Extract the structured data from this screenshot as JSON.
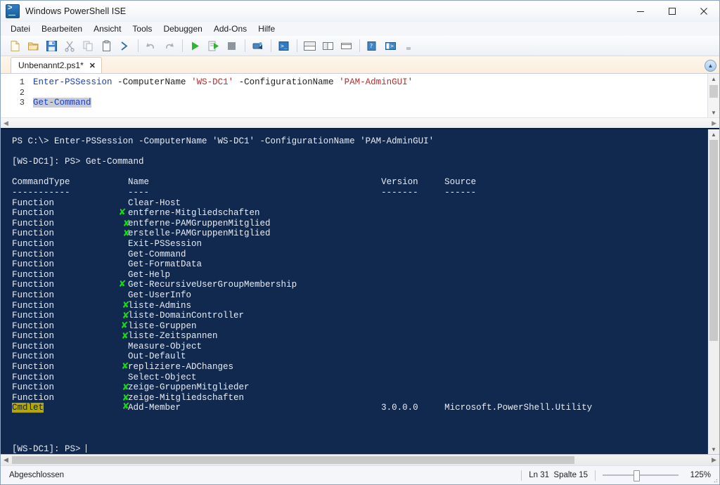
{
  "window": {
    "title": "Windows PowerShell ISE",
    "icon": "powershell-ise-icon",
    "minimize_label": "─",
    "maximize_label": "□",
    "close_label": "✕"
  },
  "menubar": {
    "items": [
      {
        "label": "Datei",
        "name": "menu-datei"
      },
      {
        "label": "Bearbeiten",
        "name": "menu-bearbeiten"
      },
      {
        "label": "Ansicht",
        "name": "menu-ansicht"
      },
      {
        "label": "Tools",
        "name": "menu-tools"
      },
      {
        "label": "Debuggen",
        "name": "menu-debuggen"
      },
      {
        "label": "Add-Ons",
        "name": "menu-add-ons"
      },
      {
        "label": "Hilfe",
        "name": "menu-hilfe"
      }
    ]
  },
  "toolbar": {
    "buttons": [
      "new-file-icon",
      "open-folder-icon",
      "save-icon",
      "cut-scissors-icon",
      "copy-icon",
      "paste-clipboard-icon",
      "run-prompt-icon",
      "undo-arrow-icon",
      "redo-arrow-icon",
      "run-script-play-icon",
      "run-selection-icon",
      "stop-script-icon",
      "new-remote-session-icon",
      "show-console-icon",
      "layout-top-bottom-icon",
      "layout-side-by-side-icon",
      "layout-maximize-icon",
      "show-script-pane-icon",
      "show-script-pane-right-icon"
    ]
  },
  "tabs": {
    "items": [
      {
        "label": "Unbenannt2.ps1*",
        "close": "✕",
        "active": true
      }
    ]
  },
  "editor": {
    "lines": [
      {
        "number": "1",
        "tokens": [
          {
            "text": "Enter-PSSession",
            "type": "cmd"
          },
          {
            "text": " -ComputerName ",
            "type": "param"
          },
          {
            "text": "'WS-DC1'",
            "type": "str"
          },
          {
            "text": " -ConfigurationName ",
            "type": "param"
          },
          {
            "text": "'PAM-AdminGUI'",
            "type": "str"
          }
        ]
      },
      {
        "number": "2",
        "tokens": []
      },
      {
        "number": "3",
        "tokens": [
          {
            "text": "Get-Command",
            "type": "sel"
          }
        ]
      }
    ],
    "collapse_icon": "▲"
  },
  "console": {
    "prompt_line_1": "PS C:\\> Enter-PSSession -ComputerName 'WS-DC1' -ConfigurationName 'PAM-AdminGUI'",
    "prompt_line_2": "[WS-DC1]: PS> Get-Command",
    "header": {
      "command_type": "CommandType",
      "name": "Name",
      "version": "Version",
      "source": "Source"
    },
    "header_rule": {
      "command_type": "-----------",
      "name": "----",
      "version": "-------",
      "source": "------"
    },
    "rows": [
      {
        "type": "Function",
        "name": "Clear-Host",
        "version": "",
        "source": "",
        "cursor": false
      },
      {
        "type": "Function",
        "name": "entferne-Mitgliedschaften",
        "version": "",
        "source": "",
        "cursor": true,
        "cursor_dx": -14,
        "cursor_dy": 0
      },
      {
        "type": "Function",
        "name": "entferne-PAMGruppenMitglied",
        "version": "",
        "source": "",
        "cursor": true,
        "cursor_dx": -8,
        "cursor_dy": 1
      },
      {
        "type": "Function",
        "name": "erstelle-PAMGruppenMitglied",
        "version": "",
        "source": "",
        "cursor": true,
        "cursor_dx": -8,
        "cursor_dy": 1
      },
      {
        "type": "Function",
        "name": "Exit-PSSession",
        "version": "",
        "source": "",
        "cursor": false
      },
      {
        "type": "Function",
        "name": "Get-Command",
        "version": "",
        "source": "",
        "cursor": false
      },
      {
        "type": "Function",
        "name": "Get-FormatData",
        "version": "",
        "source": "",
        "cursor": false
      },
      {
        "type": "Function",
        "name": "Get-Help",
        "version": "",
        "source": "",
        "cursor": false
      },
      {
        "type": "Function",
        "name": "Get-RecursiveUserGroupMembership",
        "version": "",
        "source": "",
        "cursor": true,
        "cursor_dx": -14,
        "cursor_dy": 0
      },
      {
        "type": "Function",
        "name": "Get-UserInfo",
        "version": "",
        "source": "",
        "cursor": false
      },
      {
        "type": "Function",
        "name": "liste-Admins",
        "version": "",
        "source": "",
        "cursor": true,
        "cursor_dx": -9,
        "cursor_dy": 0
      },
      {
        "type": "Function",
        "name": "liste-DomainController",
        "version": "",
        "source": "",
        "cursor": true,
        "cursor_dx": -9,
        "cursor_dy": 1
      },
      {
        "type": "Function",
        "name": "liste-Gruppen",
        "version": "",
        "source": "",
        "cursor": true,
        "cursor_dx": -11,
        "cursor_dy": 0
      },
      {
        "type": "Function",
        "name": "liste-Zeitspannen",
        "version": "",
        "source": "",
        "cursor": true,
        "cursor_dx": -10,
        "cursor_dy": 1
      },
      {
        "type": "Function",
        "name": "Measure-Object",
        "version": "",
        "source": "",
        "cursor": false
      },
      {
        "type": "Function",
        "name": "Out-Default",
        "version": "",
        "source": "",
        "cursor": false
      },
      {
        "type": "Function",
        "name": "repliziere-ADChanges",
        "version": "",
        "source": "",
        "cursor": true,
        "cursor_dx": -10,
        "cursor_dy": 0
      },
      {
        "type": "Function",
        "name": "Select-Object",
        "version": "",
        "source": "",
        "cursor": false
      },
      {
        "type": "Function",
        "name": "zeige-GruppenMitglieder",
        "version": "",
        "source": "",
        "cursor": true,
        "cursor_dx": -9,
        "cursor_dy": 1
      },
      {
        "type": "Function",
        "name": "zeige-Mitgliedschaften",
        "version": "",
        "source": "",
        "cursor": true,
        "cursor_dx": -9,
        "cursor_dy": 1
      },
      {
        "type": "Cmdlet",
        "name": "Add-Member",
        "version": "3.0.0.0",
        "source": "Microsoft.PowerShell.Utility",
        "cursor": true,
        "cursor_dx": -9,
        "cursor_dy": -1,
        "highlight": true
      }
    ],
    "final_prompt": "[WS-DC1]: PS> "
  },
  "statusbar": {
    "status": "Abgeschlossen",
    "line_col": "Ln 31  Spalte 15",
    "zoom": "125%"
  },
  "colors": {
    "console_bg": "#12294f",
    "console_fg": "#e8ecf4",
    "cursor_green": "#16d916",
    "cmdlet_highlight_bg": "#b5a800",
    "keyword_blue": "#1a3fc4",
    "string_red": "#b03030"
  }
}
